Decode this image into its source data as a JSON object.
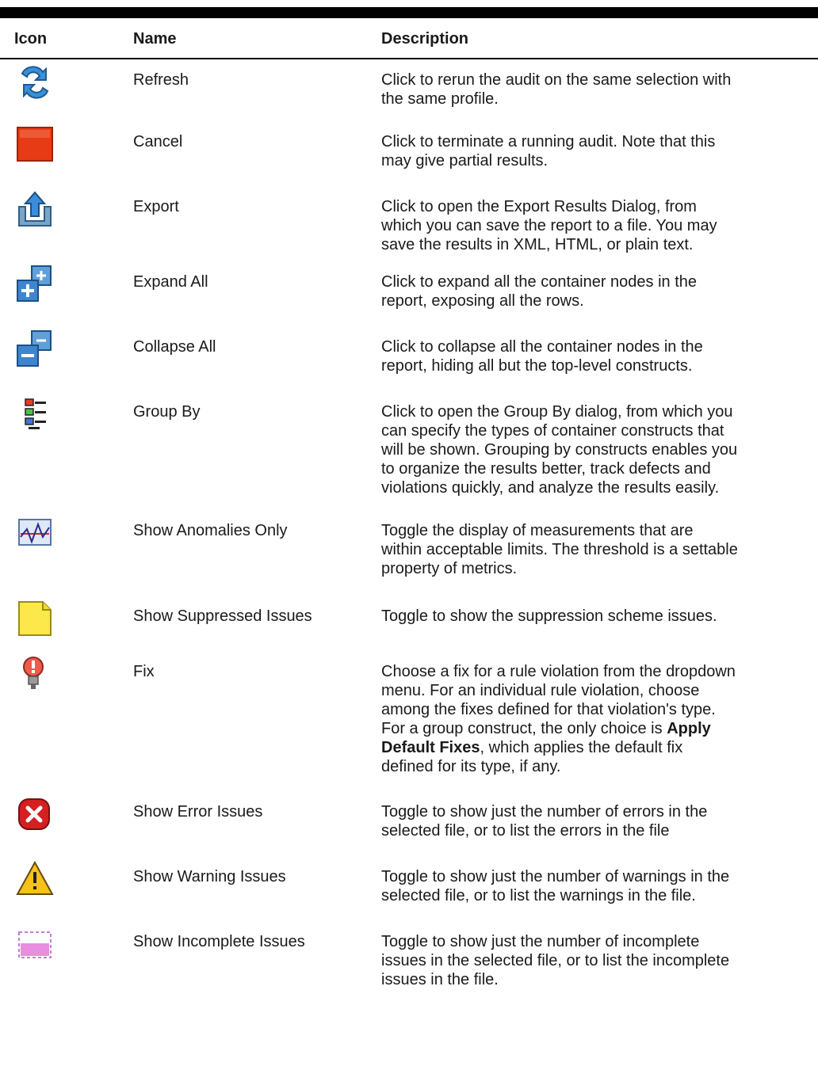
{
  "header": {
    "icon": "Icon",
    "name": "Name",
    "description": "Description"
  },
  "rows": [
    {
      "icon": "refresh-icon",
      "name": "Refresh",
      "desc": [
        "Click to rerun the audit on the same selection with",
        "the same profile."
      ]
    },
    {
      "icon": "cancel-icon",
      "name": "Cancel",
      "desc": [
        "Click to terminate a running audit. Note that this",
        "may give partial results."
      ]
    },
    {
      "icon": "export-icon",
      "name": "Export",
      "desc": [
        "Click to open the Export Results Dialog, from",
        "which you can save the report to a file. You may",
        "save the results in XML, HTML, or plain text."
      ]
    },
    {
      "icon": "expand-all-icon",
      "name": "Expand All",
      "desc": [
        "Click to expand all the container nodes in the",
        "report, exposing all the rows."
      ]
    },
    {
      "icon": "collapse-all-icon",
      "name": "Collapse All",
      "desc": [
        "Click to collapse all the container nodes in the",
        "report, hiding all but the top-level constructs."
      ]
    },
    {
      "icon": "group-by-icon",
      "name": "Group By",
      "desc": [
        "Click to open the Group By dialog, from which you",
        "can specify the types of container constructs that",
        "will be shown. Grouping by constructs enables you",
        "to organize the results better, track defects and",
        "violations quickly, and analyze the results easily."
      ]
    },
    {
      "icon": "anomalies-chart-icon",
      "name": "Show Anomalies Only",
      "desc": [
        "Toggle the display of measurements that are",
        "within acceptable limits. The threshold is a settable",
        "property of metrics."
      ]
    },
    {
      "icon": "note-icon",
      "name": "Show Suppressed Issues",
      "desc": [
        "Toggle to show the suppression scheme issues."
      ]
    },
    {
      "icon": "lightbulb-icon",
      "name": "Fix",
      "desc": [
        "Choose a fix for a rule violation from the dropdown",
        "menu. For an individual rule violation, choose",
        "among the fixes defined for that violation's type.",
        "For a group construct, the only choice is |Apply|",
        "|Default Fixes|, which applies the default fix",
        "defined for its type, if any."
      ]
    },
    {
      "icon": "error-icon",
      "name": "Show Error Issues",
      "desc": [
        "Toggle to show just the number of errors in the",
        "selected file, or to list the errors in the file"
      ]
    },
    {
      "icon": "warning-icon",
      "name": "Show Warning Issues",
      "desc": [
        "Toggle to show just the number of warnings in the",
        "selected file, or to list the warnings in the file."
      ]
    },
    {
      "icon": "incomplete-icon",
      "name": "Show Incomplete Issues",
      "desc": [
        "Toggle to show just the number of incomplete",
        "issues in the selected file, or to list the incomplete",
        "issues in the file."
      ]
    }
  ]
}
